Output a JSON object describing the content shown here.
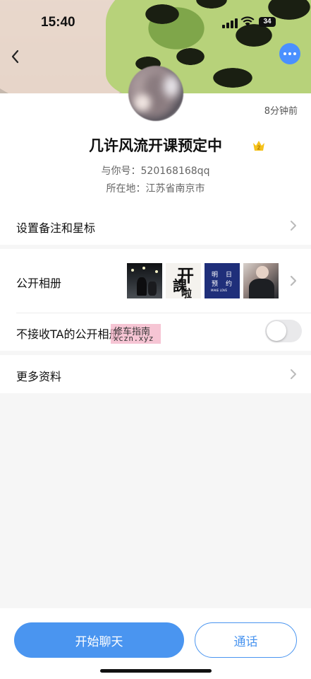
{
  "status_bar": {
    "time": "15:40",
    "battery": "34"
  },
  "profile": {
    "time_ago": "8分钟前",
    "name": "几许风流开课预定中",
    "level_badge": "2",
    "account_line": "与你号：520168168qq",
    "location_line": "所在地：江苏省南京市"
  },
  "rows": {
    "remark": "设置备注和星标",
    "album": "公开相册",
    "block_album": "不接收TA的公开相册",
    "more_info": "更多资料"
  },
  "album_thumbs": [
    {
      "name": "gym-photo"
    },
    {
      "name": "kaike-la-calligraphy",
      "text_big": "开",
      "text_mid": "課",
      "text_small": "啦"
    },
    {
      "name": "mingri-yuyue-card",
      "line1a": "明",
      "line1b": "日",
      "line2a": "预",
      "line2b": "约",
      "line3": "MAKE LOVE"
    },
    {
      "name": "portrait-photo"
    }
  ],
  "toggle": {
    "on": false
  },
  "watermark": {
    "line1": "修车指南",
    "line2": "xczn.xyz"
  },
  "buttons": {
    "chat": "开始聊天",
    "call": "通话"
  },
  "colors": {
    "accent": "#4a95f0",
    "more_button": "#4a90ff"
  }
}
